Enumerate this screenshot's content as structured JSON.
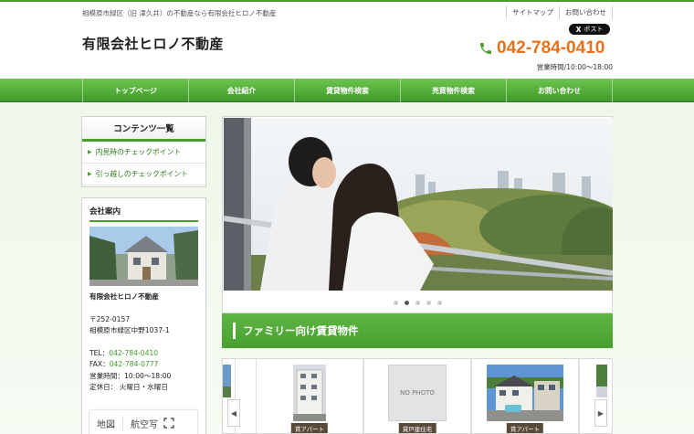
{
  "header": {
    "tagline": "相模原市緑区（旧 津久井）の不動産なら有限会社ヒロノ不動産",
    "links": [
      {
        "label": "サイトマップ"
      },
      {
        "label": "お問い合わせ"
      }
    ],
    "x_post_label": "ポスト",
    "x_logo": "X",
    "company_name": "有限会社ヒロノ不動産",
    "phone": "042-784-0410",
    "phone_icon": "phone-icon",
    "hours": "営業時間/10:00〜18:00"
  },
  "nav": [
    {
      "label": "トップページ"
    },
    {
      "label": "会社紹介"
    },
    {
      "label": "賃貸物件検索"
    },
    {
      "label": "売買物件検索"
    },
    {
      "label": "お問い合わせ"
    }
  ],
  "sidebar": {
    "contents_title": "コンテンツ一覧",
    "contents_items": [
      {
        "label": "内見時のチェックポイント"
      },
      {
        "label": "引っ越しのチェックポイント"
      }
    ],
    "company_title": "会社案内",
    "company_name": "有限会社ヒロノ不動産",
    "zip": "〒252-0157",
    "address": "相模原市緑区中野1037-1",
    "tel_label": "TEL：",
    "tel": "042-784-0410",
    "fax_label": "FAX：",
    "fax": "042-784-0777",
    "hours": "営業時間：10:00〜18:00",
    "holidays": "定休日： 火曜日・水曜日",
    "map_tab_map": "地図",
    "map_tab_aerial": "航空写"
  },
  "slider": {
    "slide_count": 5,
    "active_index": 1
  },
  "section": {
    "title": "ファミリー向け賃貸物件"
  },
  "properties": [
    {
      "badge": "賃アパート",
      "photo": "apartment"
    },
    {
      "badge": "貸戸建住宅",
      "photo": "none",
      "no_photo_label": "NO PHOTO"
    },
    {
      "badge": "賃アパート",
      "photo": "apartment-color"
    }
  ],
  "colors": {
    "brand_green": "#4a9e2f",
    "phone_orange": "#e9711c"
  }
}
